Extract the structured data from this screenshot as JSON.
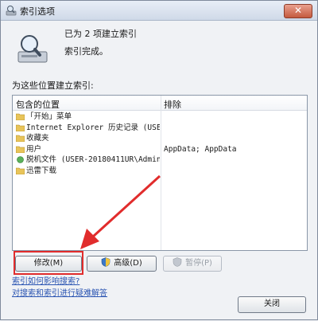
{
  "window": {
    "title": "索引选项",
    "close_glyph": "✕"
  },
  "header": {
    "status_line1": "已为 2 项建立索引",
    "status_line2": "索引完成。"
  },
  "locations": {
    "label": "为这些位置建立索引:",
    "col_included": "包含的位置",
    "col_excluded": "排除",
    "rows": [
      {
        "name": "「开始」菜单",
        "excluded": ""
      },
      {
        "name": "Internet Explorer 历史记录 (USE...",
        "excluded": ""
      },
      {
        "name": "收藏夹",
        "excluded": ""
      },
      {
        "name": "用户",
        "excluded": "AppData; AppData"
      },
      {
        "name": "脱机文件 (USER-20180411UR\\Admin...",
        "excluded": ""
      },
      {
        "name": "迅雷下载",
        "excluded": ""
      }
    ]
  },
  "buttons": {
    "modify": "修改(M)",
    "advanced": "高级(D)",
    "pause": "暂停(P)",
    "close": "关闭"
  },
  "links": {
    "how_affects": "索引如何影响搜索?",
    "troubleshoot": "对搜索和索引进行疑难解答"
  },
  "colors": {
    "annotation": "#e12c2c",
    "link": "#2b55b2"
  }
}
